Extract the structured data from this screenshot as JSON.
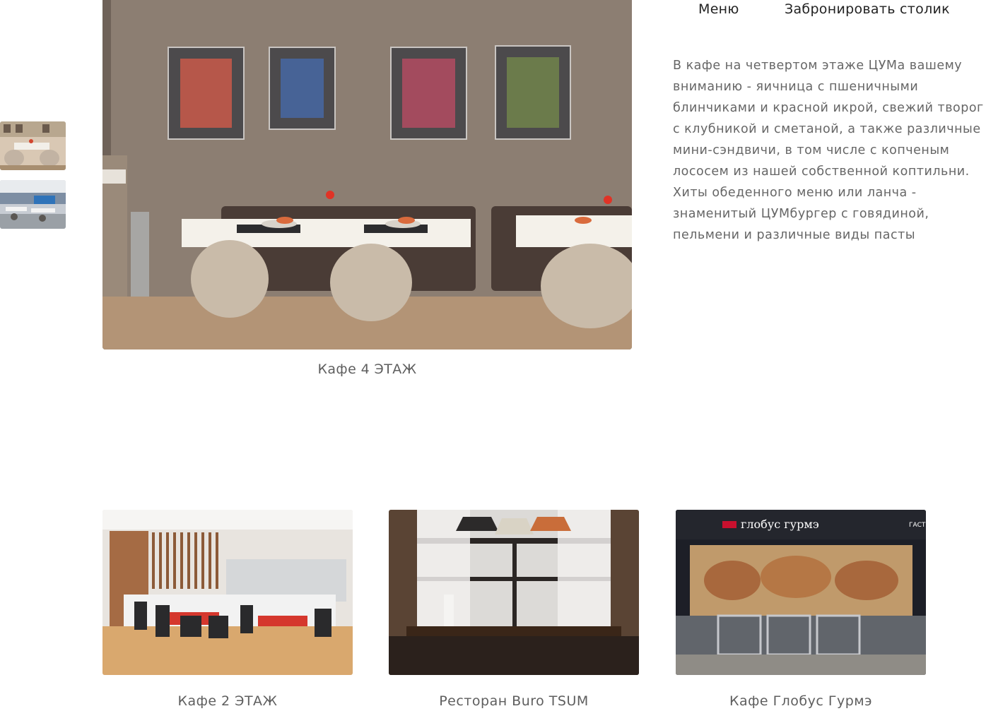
{
  "nav": {
    "menu_label": "Меню",
    "book_label": "Забронировать столик"
  },
  "hero": {
    "caption": "Кафе 4 ЭТАЖ"
  },
  "description": {
    "lines": [
      "В кафе на четвертом этаже ЦУМа вашему",
      "вниманию - яичница с пшеничными",
      "блинчиками и красной икрой, свежий творог",
      "с клубникой и сметаной, а также различные",
      "мини-сэндвичи, в том числе с копченым",
      "лососем из нашей собственной коптильни.",
      "Хиты обеденного меню или ланча -",
      "знаменитый ЦУМбургер с говядиной,",
      "пельмени и различные виды пасты"
    ]
  },
  "cards": [
    {
      "caption": "Кафе 2 ЭТАЖ"
    },
    {
      "caption": "Ресторан Buro TSUM"
    },
    {
      "caption": "Кафе Глобус Гурмэ",
      "sign_text": "глобус гурмэ",
      "sign_extra": "ГАСТ"
    }
  ],
  "colors": {
    "text": "#5e5e5e",
    "nav_text": "#222222",
    "sign_red": "#c8102e"
  }
}
